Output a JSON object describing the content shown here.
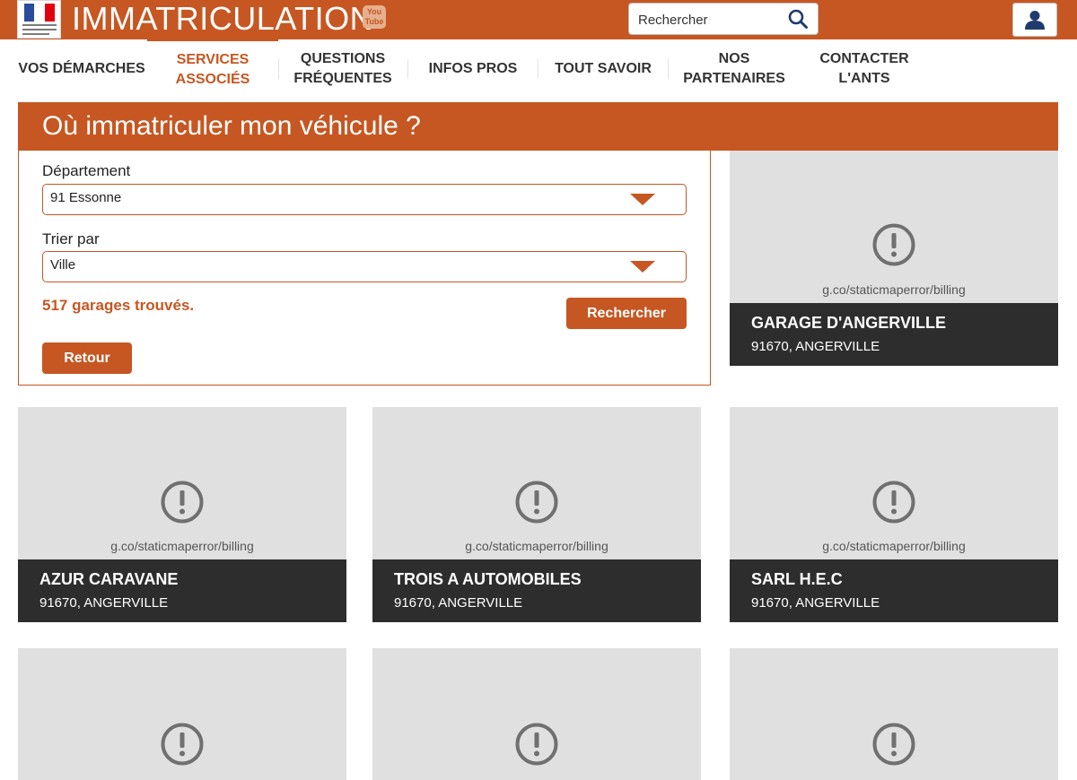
{
  "header": {
    "title": "IMMATRICULATION",
    "youtube_label": "You Tube",
    "search_placeholder": "Rechercher",
    "logo_icon": "marianne-logo-icon",
    "search_icon": "search-icon",
    "account_icon": "user-icon"
  },
  "nav": {
    "items": [
      {
        "label": "VOS DÉMARCHES"
      },
      {
        "label": "SERVICES ASSOCIÉS",
        "active": true
      },
      {
        "label": "QUESTIONS FRÉQUENTES"
      },
      {
        "label": "INFOS PROS"
      },
      {
        "label": "TOUT SAVOIR"
      },
      {
        "label": "NOS PARTENAIRES"
      },
      {
        "label": "CONTACTER L'ANTS"
      }
    ]
  },
  "page": {
    "heading": "Où immatriculer mon véhicule ?"
  },
  "form": {
    "departement_label": "Département",
    "departement_value": "91 Essonne",
    "sort_label": "Trier par",
    "sort_value": "Ville",
    "results_text": "517 garages trouvés.",
    "search_button": "Rechercher",
    "back_button": "Retour"
  },
  "map_error_text": "g.co/staticmaperror/billing",
  "garages": [
    {
      "name": "GARAGE D'ANGERVILLE",
      "address": "91670, ANGERVILLE"
    },
    {
      "name": "AZUR CARAVANE",
      "address": "91670, ANGERVILLE"
    },
    {
      "name": "TROIS A AUTOMOBILES",
      "address": "91670, ANGERVILLE"
    },
    {
      "name": "SARL H.E.C",
      "address": "91670, ANGERVILLE"
    }
  ],
  "colors": {
    "brand": "#c65722",
    "card_info_bg": "#2d2d2d",
    "map_bg": "#e0e0e0"
  }
}
